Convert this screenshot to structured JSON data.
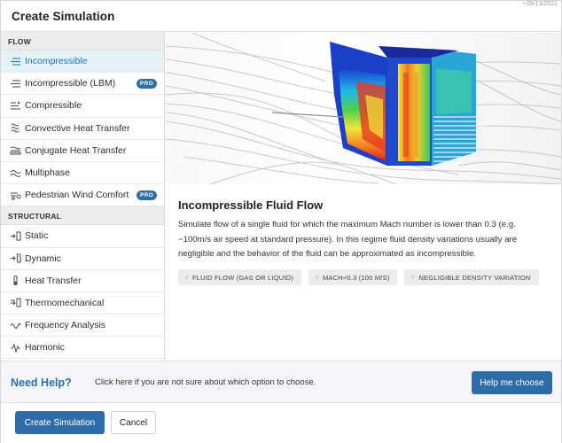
{
  "dialog": {
    "title": "Create Simulation",
    "corner_text": "• 09/13/2021"
  },
  "sidebar": {
    "sections": [
      {
        "label": "FLOW",
        "items": [
          {
            "label": "Incompressible",
            "icon": "incompressible-icon",
            "active": true,
            "pro": ""
          },
          {
            "label": "Incompressible (LBM)",
            "icon": "lbm-icon",
            "active": false,
            "pro": "PRO"
          },
          {
            "label": "Compressible",
            "icon": "compressible-icon",
            "active": false,
            "pro": ""
          },
          {
            "label": "Convective Heat Transfer",
            "icon": "convective-heat-icon",
            "active": false,
            "pro": ""
          },
          {
            "label": "Conjugate Heat Transfer",
            "icon": "conjugate-heat-icon",
            "active": false,
            "pro": ""
          },
          {
            "label": "Multiphase",
            "icon": "multiphase-icon",
            "active": false,
            "pro": ""
          },
          {
            "label": "Pedestrian Wind Comfort",
            "icon": "pedestrian-wind-icon",
            "active": false,
            "pro": "PRO"
          }
        ]
      },
      {
        "label": "STRUCTURAL",
        "items": [
          {
            "label": "Static",
            "icon": "static-icon",
            "active": false,
            "pro": ""
          },
          {
            "label": "Dynamic",
            "icon": "dynamic-icon",
            "active": false,
            "pro": ""
          },
          {
            "label": "Heat Transfer",
            "icon": "thermometer-icon",
            "active": false,
            "pro": ""
          },
          {
            "label": "Thermomechanical",
            "icon": "thermomechanical-icon",
            "active": false,
            "pro": ""
          },
          {
            "label": "Frequency Analysis",
            "icon": "frequency-icon",
            "active": false,
            "pro": ""
          },
          {
            "label": "Harmonic",
            "icon": "harmonic-icon",
            "active": false,
            "pro": ""
          }
        ]
      }
    ]
  },
  "detail": {
    "title": "Incompressible Fluid Flow",
    "description": "Simulate flow of a single fluid for which the maximum Mach number is lower than 0.3 (e.g. ~100m/s air speed at standard pressure). In this regime fluid density variations usually are negligible and the behavior of the fluid can be approximated as incompressible.",
    "tags": [
      "FLUID FLOW (GAS OR LIQUID)",
      "MACH<0.3 (100 M/S)",
      "NEGLIGIBLE DENSITY VARIATION"
    ]
  },
  "help": {
    "title": "Need Help?",
    "text": "Click here if you are not sure about which option to choose.",
    "button": "Help me choose"
  },
  "footer": {
    "create_label": "Create Simulation",
    "cancel_label": "Cancel"
  },
  "colors": {
    "accent": "#2d6ca8",
    "active_bg": "#e4f1f8",
    "active_text": "#1f77b4",
    "section_bg": "#ececec"
  }
}
